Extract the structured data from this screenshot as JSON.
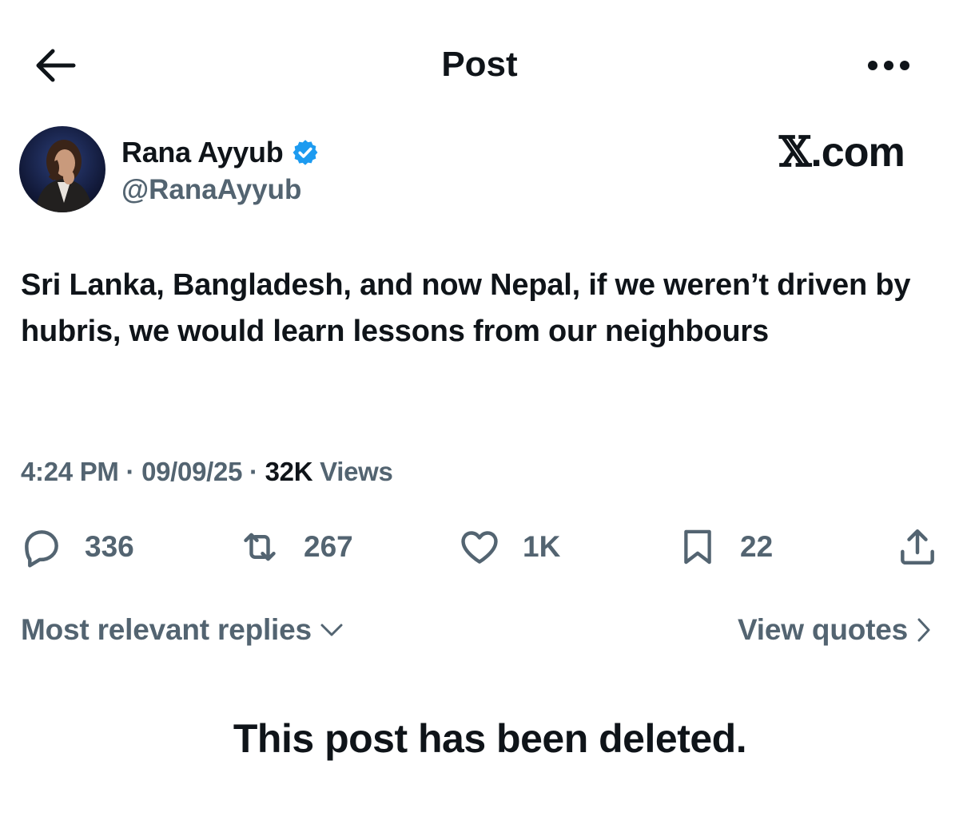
{
  "header": {
    "title": "Post",
    "back_icon": "arrow-left-icon",
    "more_icon": "more-horizontal-icon"
  },
  "author": {
    "name": "Rana Ayyub",
    "handle": "@RanaAyyub",
    "verified": true,
    "verified_color": "#1d9bf0"
  },
  "watermark": {
    "x_glyph": "𝕏",
    "suffix": ".com"
  },
  "post": {
    "text": "Sri Lanka, Bangladesh, and now Nepal, if we weren’t driven by hubris, we would learn lessons from our neighbours",
    "time": "4:24 PM",
    "date": "09/09/25",
    "separator": "·",
    "views_count": "32K",
    "views_label": "Views"
  },
  "actions": {
    "replies": "336",
    "reposts": "267",
    "likes": "1K",
    "bookmarks": "22"
  },
  "replies_bar": {
    "sort_label": "Most relevant replies",
    "quotes_label": "View quotes"
  },
  "deleted_notice": "This post has been deleted.",
  "colors": {
    "text_primary": "#0f1419",
    "text_secondary": "#536471",
    "accent": "#1d9bf0"
  }
}
